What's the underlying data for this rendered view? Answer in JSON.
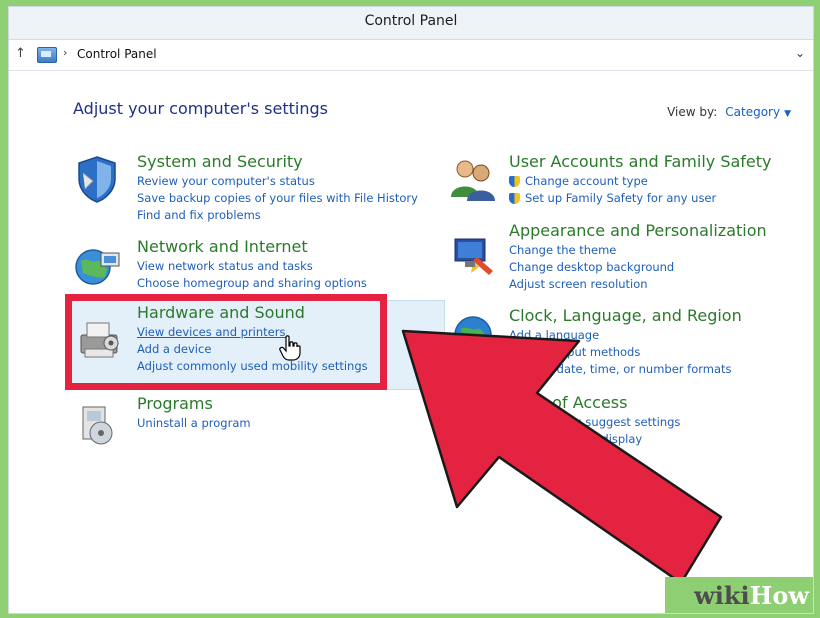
{
  "window": {
    "title": "Control Panel"
  },
  "address_bar": {
    "up_icon": "up-arrow-icon",
    "separator": "›",
    "crumb": "Control Panel",
    "dropdown_glyph": "⌄"
  },
  "main": {
    "heading": "Adjust your computer's settings",
    "view_by": {
      "label": "View by:",
      "value": "Category",
      "caret": "▼"
    }
  },
  "categories": [
    {
      "title": "System and Security",
      "icon": "shield-icon",
      "links": [
        "Review your computer's status",
        "Save backup copies of your files with File History",
        "Find and fix problems"
      ]
    },
    {
      "title": "Network and Internet",
      "icon": "network-globe-icon",
      "links": [
        "View network status and tasks",
        "Choose homegroup and sharing options"
      ]
    },
    {
      "title": "Hardware and Sound",
      "icon": "printer-icon",
      "links": [
        "View devices and printers",
        "Add a device",
        "Adjust commonly used mobility settings"
      ]
    },
    {
      "title": "Programs",
      "icon": "programs-icon",
      "links": [
        "Uninstall a program"
      ]
    },
    {
      "title": "User Accounts and Family Safety",
      "icon": "users-icon",
      "links": [
        "Change account type",
        "Set up Family Safety for any user"
      ]
    },
    {
      "title": "Appearance and Personalization",
      "icon": "appearance-icon",
      "links": [
        "Change the theme",
        "Change desktop background",
        "Adjust screen resolution"
      ]
    },
    {
      "title": "Clock, Language, and Region",
      "icon": "clock-globe-icon",
      "links": [
        "Add a language",
        "Change input methods",
        "Change date, time, or number formats"
      ]
    },
    {
      "title": "Ease of Access",
      "icon": "ease-of-access-icon",
      "links": [
        "Let Windows suggest settings",
        "Optimize visual display"
      ]
    }
  ],
  "watermark": {
    "part1": "wiki",
    "part2": "How"
  },
  "colors": {
    "highlight_box": "#e3233f",
    "arrow": "#e3233f",
    "link": "#1f5fb8",
    "category_title": "#2b7a2b",
    "heading": "#1e3287"
  }
}
